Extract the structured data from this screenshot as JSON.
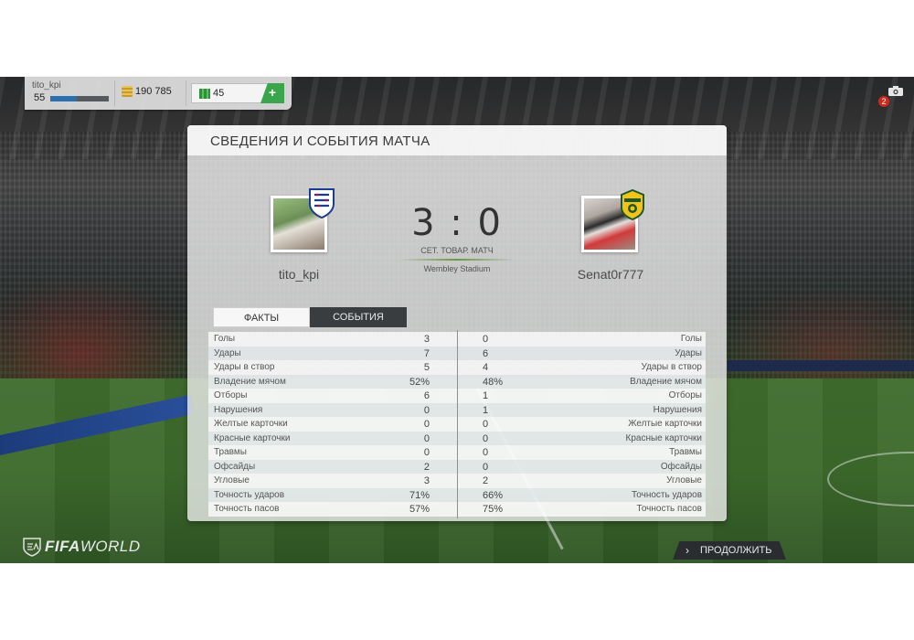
{
  "topbar": {
    "username": "tito_kpi",
    "level": "55",
    "xp_progress": 0.45,
    "coins": "190 785",
    "points": "45",
    "add_label": "+"
  },
  "notifications": {
    "count": "2"
  },
  "panel": {
    "title": "СВЕДЕНИЯ И СОБЫТИЯ МАТЧА",
    "home_team": "tito_kpi",
    "away_team": "Senat0r777",
    "score": "3 : 0",
    "match_type": "СЕТ. ТОВАР. МАТЧ",
    "stadium": "Wembley Stadium"
  },
  "tabs": [
    {
      "label": "ФАКТЫ",
      "active": true
    },
    {
      "label": "СОБЫТИЯ",
      "active": false
    }
  ],
  "stats": [
    {
      "label": "Голы",
      "home": "3",
      "away": "0"
    },
    {
      "label": "Удары",
      "home": "7",
      "away": "6"
    },
    {
      "label": "Удары в створ",
      "home": "5",
      "away": "4"
    },
    {
      "label": "Владение мячом",
      "home": "52%",
      "away": "48%"
    },
    {
      "label": "Отборы",
      "home": "6",
      "away": "1"
    },
    {
      "label": "Нарушения",
      "home": "0",
      "away": "1"
    },
    {
      "label": "Желтые карточки",
      "home": "0",
      "away": "0"
    },
    {
      "label": "Красные карточки",
      "home": "0",
      "away": "0"
    },
    {
      "label": "Травмы",
      "home": "0",
      "away": "0"
    },
    {
      "label": "Офсайды",
      "home": "2",
      "away": "0"
    },
    {
      "label": "Угловые",
      "home": "3",
      "away": "2"
    },
    {
      "label": "Точность ударов",
      "home": "71%",
      "away": "66%"
    },
    {
      "label": "Точность пасов",
      "home": "57%",
      "away": "75%"
    }
  ],
  "footer": {
    "logo_a": "FIFA",
    "logo_b": "WORLD",
    "continue_label": "ПРОДОЛЖИТЬ"
  },
  "colors": {
    "accent_green": "#3aa54a",
    "xp_blue": "#2a6fb0",
    "badge_red": "#d0271d"
  }
}
